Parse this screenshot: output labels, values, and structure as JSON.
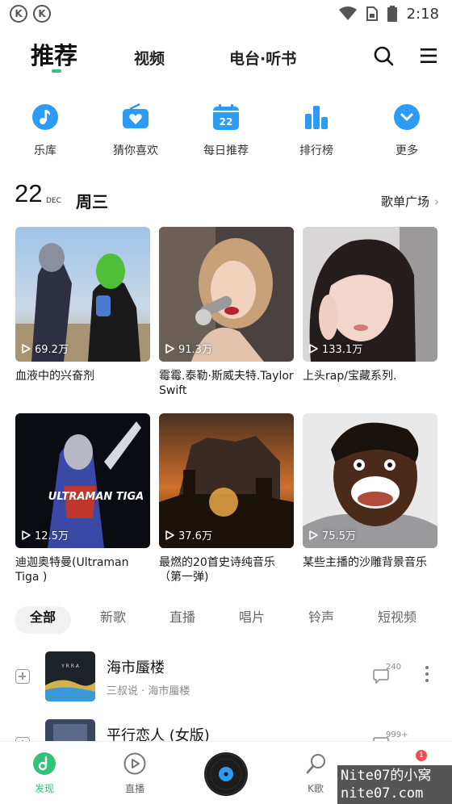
{
  "status_bar": {
    "left_icons": [
      "K",
      "K"
    ],
    "time": "2:18",
    "icons": [
      "wifi-icon",
      "sim-icon",
      "battery-icon"
    ]
  },
  "top_nav": {
    "tabs": [
      {
        "label": "推荐",
        "active": true
      },
      {
        "label": "视频",
        "active": false
      },
      {
        "label": "电台·听书",
        "active": false
      }
    ],
    "icons": [
      "search-icon",
      "menu-icon"
    ],
    "accent": "#31c27c"
  },
  "quick_entries": [
    {
      "label": "乐库",
      "icon": "music-note-icon"
    },
    {
      "label": "猜你喜欢",
      "icon": "radio-heart-icon"
    },
    {
      "label": "每日推荐",
      "icon": "calendar-icon",
      "icon_text": "22"
    },
    {
      "label": "排行榜",
      "icon": "ranking-bars-icon"
    },
    {
      "label": "更多",
      "icon": "chevron-down-circle-icon"
    }
  ],
  "quick_icon_color": "#2b9bf4",
  "date_header": {
    "day": "22",
    "month": "DEC",
    "weekday": "周三",
    "link": "歌单广场"
  },
  "playlists": [
    {
      "plays": "69.2万",
      "title": "血液中的兴奋剂"
    },
    {
      "plays": "91.3万",
      "title": "霉霉.泰勒·斯威夫特.Taylor Swift"
    },
    {
      "plays": "133.1万",
      "title": "上头rap/宝藏系列."
    },
    {
      "plays": "12.5万",
      "title": "迪迦奥特曼(Ultraman Tiga )",
      "cover_text": "ULTRAMAN TIGA"
    },
    {
      "plays": "37.6万",
      "title": "最燃的20首史诗纯音乐（第一弹)"
    },
    {
      "plays": "75.5万",
      "title": "某些主播的沙雕背景音乐"
    }
  ],
  "filters": [
    "全部",
    "新歌",
    "直播",
    "唱片",
    "铃声",
    "短视频"
  ],
  "songs": [
    {
      "name": "海市蜃楼",
      "sub": "三叔说 · 海市蜃楼",
      "comments": "240",
      "cover_text": "Y R R A"
    },
    {
      "name": "平行恋人 (女版)",
      "sub": "",
      "comments": "999+"
    }
  ],
  "bottom_bar": {
    "items": [
      {
        "label": "发现",
        "icon": "discover-icon",
        "active": true
      },
      {
        "label": "直播",
        "icon": "live-play-icon",
        "active": false
      },
      {
        "label": "K歌",
        "icon": "microphone-icon",
        "active": false
      }
    ],
    "badge": "1"
  },
  "watermark": {
    "line1": "Nite07的小窝",
    "line2": "nite07.com"
  }
}
